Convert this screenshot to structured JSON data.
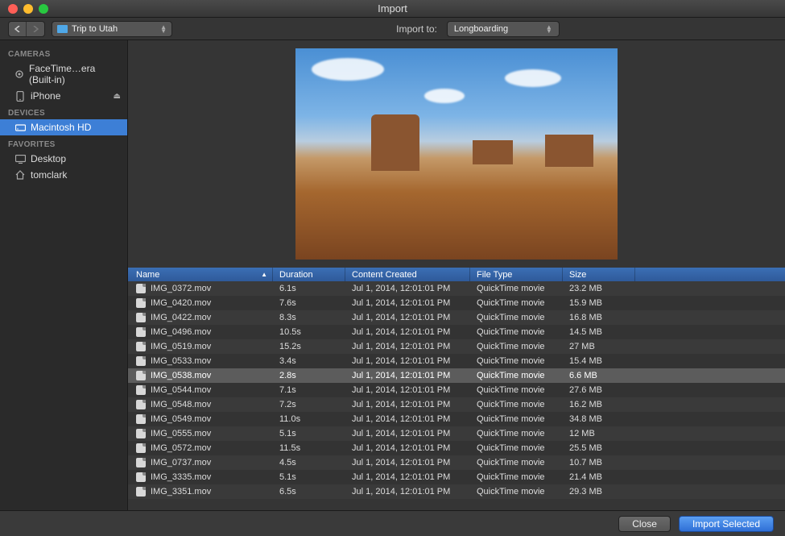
{
  "window": {
    "title": "Import"
  },
  "toolbar": {
    "path_label": "Trip to Utah",
    "import_to_label": "Import to:",
    "import_to_value": "Longboarding"
  },
  "sidebar": {
    "sections": [
      {
        "header": "CAMERAS",
        "items": [
          {
            "label": "FaceTime…era (Built-in)",
            "icon": "camera-icon",
            "eject": false
          },
          {
            "label": "iPhone",
            "icon": "phone-icon",
            "eject": true
          }
        ]
      },
      {
        "header": "DEVICES",
        "items": [
          {
            "label": "Macintosh HD",
            "icon": "hdd-icon",
            "selected": true
          }
        ]
      },
      {
        "header": "FAVORITES",
        "items": [
          {
            "label": "Desktop",
            "icon": "desktop-icon"
          },
          {
            "label": "tomclark",
            "icon": "home-icon"
          }
        ]
      }
    ]
  },
  "table": {
    "columns": {
      "name": "Name",
      "duration": "Duration",
      "created": "Content Created",
      "filetype": "File Type",
      "size": "Size"
    },
    "rows": [
      {
        "name": "IMG_0372.mov",
        "duration": "6.1s",
        "created": "Jul 1, 2014, 12:01:01 PM",
        "filetype": "QuickTime movie",
        "size": "23.2 MB"
      },
      {
        "name": "IMG_0420.mov",
        "duration": "7.6s",
        "created": "Jul 1, 2014, 12:01:01 PM",
        "filetype": "QuickTime movie",
        "size": "15.9 MB"
      },
      {
        "name": "IMG_0422.mov",
        "duration": "8.3s",
        "created": "Jul 1, 2014, 12:01:01 PM",
        "filetype": "QuickTime movie",
        "size": "16.8 MB"
      },
      {
        "name": "IMG_0496.mov",
        "duration": "10.5s",
        "created": "Jul 1, 2014, 12:01:01 PM",
        "filetype": "QuickTime movie",
        "size": "14.5 MB"
      },
      {
        "name": "IMG_0519.mov",
        "duration": "15.2s",
        "created": "Jul 1, 2014, 12:01:01 PM",
        "filetype": "QuickTime movie",
        "size": "27 MB"
      },
      {
        "name": "IMG_0533.mov",
        "duration": "3.4s",
        "created": "Jul 1, 2014, 12:01:01 PM",
        "filetype": "QuickTime movie",
        "size": "15.4 MB"
      },
      {
        "name": "IMG_0538.mov",
        "duration": "2.8s",
        "created": "Jul 1, 2014, 12:01:01 PM",
        "filetype": "QuickTime movie",
        "size": "6.6 MB",
        "selected": true
      },
      {
        "name": "IMG_0544.mov",
        "duration": "7.1s",
        "created": "Jul 1, 2014, 12:01:01 PM",
        "filetype": "QuickTime movie",
        "size": "27.6 MB"
      },
      {
        "name": "IMG_0548.mov",
        "duration": "7.2s",
        "created": "Jul 1, 2014, 12:01:01 PM",
        "filetype": "QuickTime movie",
        "size": "16.2 MB"
      },
      {
        "name": "IMG_0549.mov",
        "duration": "11.0s",
        "created": "Jul 1, 2014, 12:01:01 PM",
        "filetype": "QuickTime movie",
        "size": "34.8 MB"
      },
      {
        "name": "IMG_0555.mov",
        "duration": "5.1s",
        "created": "Jul 1, 2014, 12:01:01 PM",
        "filetype": "QuickTime movie",
        "size": "12 MB"
      },
      {
        "name": "IMG_0572.mov",
        "duration": "11.5s",
        "created": "Jul 1, 2014, 12:01:01 PM",
        "filetype": "QuickTime movie",
        "size": "25.5 MB"
      },
      {
        "name": "IMG_0737.mov",
        "duration": "4.5s",
        "created": "Jul 1, 2014, 12:01:01 PM",
        "filetype": "QuickTime movie",
        "size": "10.7 MB"
      },
      {
        "name": "IMG_3335.mov",
        "duration": "5.1s",
        "created": "Jul 1, 2014, 12:01:01 PM",
        "filetype": "QuickTime movie",
        "size": "21.4 MB"
      },
      {
        "name": "IMG_3351.mov",
        "duration": "6.5s",
        "created": "Jul 1, 2014, 12:01:01 PM",
        "filetype": "QuickTime movie",
        "size": "29.3 MB"
      }
    ]
  },
  "footer": {
    "close": "Close",
    "import": "Import Selected"
  }
}
